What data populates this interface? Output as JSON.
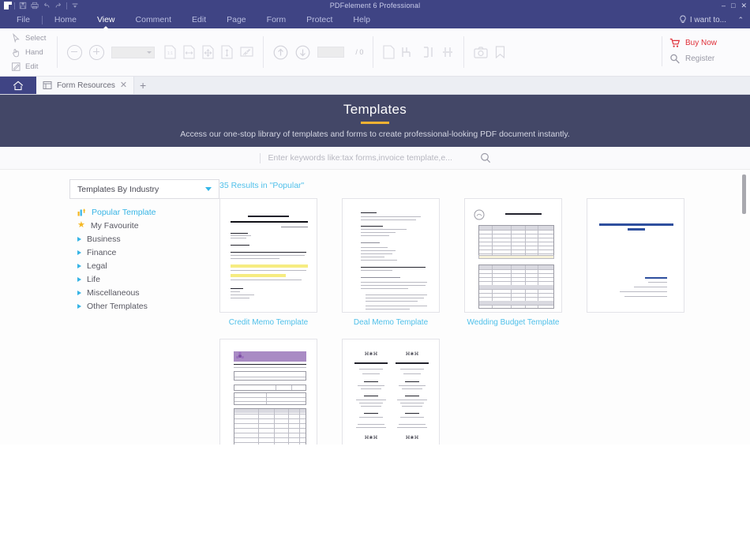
{
  "window": {
    "app_title": "PDFelement 6 Professional",
    "minimize": "–",
    "maximize": "□",
    "close": "✕",
    "collapse_ribbon": "⌃",
    "logo_icon": "pdfelement-logo-icon",
    "quick_access": [
      {
        "name": "save-icon",
        "label": "Save"
      },
      {
        "name": "print-icon",
        "label": "Print"
      },
      {
        "name": "undo-icon",
        "label": "Undo"
      },
      {
        "name": "redo-icon",
        "label": "Redo"
      },
      {
        "name": "customize-quick-access-icon",
        "label": "Customize"
      }
    ]
  },
  "menubar": {
    "items": [
      {
        "label": "File",
        "active": false
      },
      {
        "label": "Home",
        "active": false
      },
      {
        "label": "View",
        "active": true
      },
      {
        "label": "Comment",
        "active": false
      },
      {
        "label": "Edit",
        "active": false
      },
      {
        "label": "Page",
        "active": false
      },
      {
        "label": "Form",
        "active": false
      },
      {
        "label": "Protect",
        "active": false
      },
      {
        "label": "Help",
        "active": false
      }
    ],
    "i_want_to": "I want to...",
    "i_want_to_icon": "lightbulb-icon"
  },
  "ribbon": {
    "tools": [
      {
        "label": "Select",
        "icon": "cursor-arrow-icon"
      },
      {
        "label": "Hand",
        "icon": "hand-icon"
      },
      {
        "label": "Edit",
        "icon": "pencil-edit-icon"
      }
    ],
    "zoom_out_icon": "zoom-out-icon",
    "zoom_in_icon": "zoom-in-icon",
    "zoom_value": "",
    "view_icons": [
      {
        "name": "actual-size-icon",
        "label": "1:1"
      },
      {
        "name": "fit-width-icon",
        "label": "Fit Width"
      },
      {
        "name": "fit-page-icon",
        "label": "Fit Page"
      },
      {
        "name": "fit-height-icon",
        "label": "Fit Height"
      },
      {
        "name": "full-screen-icon",
        "label": "Full Screen"
      }
    ],
    "previous_page_icon": "arrow-up-circle-icon",
    "next_page_icon": "arrow-down-circle-icon",
    "page_number_value": "",
    "page_count": "/ 0",
    "layout_icons": [
      {
        "name": "single-page-icon",
        "label": "Single Page"
      },
      {
        "name": "split-horizontal-icon",
        "label": "Split"
      },
      {
        "name": "split-vertical-icon",
        "label": "Vertical Split"
      },
      {
        "name": "continuous-scroll-icon",
        "label": "Continuous"
      }
    ],
    "snapshot_icon": "camera-snapshot-icon",
    "bookmark_icon": "bookmark-icon",
    "buy_now": "Buy Now",
    "buy_now_icon": "shopping-cart-icon",
    "register": "Register",
    "register_icon": "key-search-icon"
  },
  "tabstrip": {
    "home_tab_icon": "home-icon",
    "tabs": [
      {
        "label": "Form Resources",
        "icon": "form-document-icon",
        "close": "✕"
      }
    ],
    "new_tab": "+"
  },
  "banner": {
    "title": "Templates",
    "subtitle": "Access our one-stop library of templates and forms to create professional-looking PDF document instantly."
  },
  "search": {
    "placeholder": "Enter keywords like:tax forms,invoice template,e...",
    "value": "",
    "icon": "search-icon"
  },
  "sidebar": {
    "dropdown_label": "Templates By Industry",
    "dropdown_icon": "chevron-down-icon",
    "items": [
      {
        "label": "Popular Template",
        "icon": "popular-chart-icon",
        "active": true
      },
      {
        "label": "My Favourite",
        "icon": "star-icon",
        "active": false
      },
      {
        "label": "Business",
        "icon": "triangle-right-icon",
        "active": false
      },
      {
        "label": "Finance",
        "icon": "triangle-right-icon",
        "active": false
      },
      {
        "label": "Legal",
        "icon": "triangle-right-icon",
        "active": false
      },
      {
        "label": "Life",
        "icon": "triangle-right-icon",
        "active": false
      },
      {
        "label": "Miscellaneous",
        "icon": "triangle-right-icon",
        "active": false
      },
      {
        "label": "Other Templates",
        "icon": "triangle-right-icon",
        "active": false
      }
    ]
  },
  "results": {
    "count_text": "35  Results in \"Popular\"",
    "templates": [
      {
        "title": "Credit Memo Template",
        "art": "credit-memo"
      },
      {
        "title": "Deal Memo Template",
        "art": "deal-memo"
      },
      {
        "title": "Wedding Budget Template",
        "art": "wedding-budget"
      },
      {
        "title": "",
        "art": "contractor-agreement"
      },
      {
        "title": "",
        "art": "family-budget"
      },
      {
        "title": "",
        "art": "wedding-menu"
      }
    ]
  },
  "colors": {
    "title_bar": "#3f4484",
    "banner": "#434767",
    "accent_yellow": "#f0b233",
    "link_blue": "#4fc0ea",
    "buy_red": "#df2f38"
  }
}
